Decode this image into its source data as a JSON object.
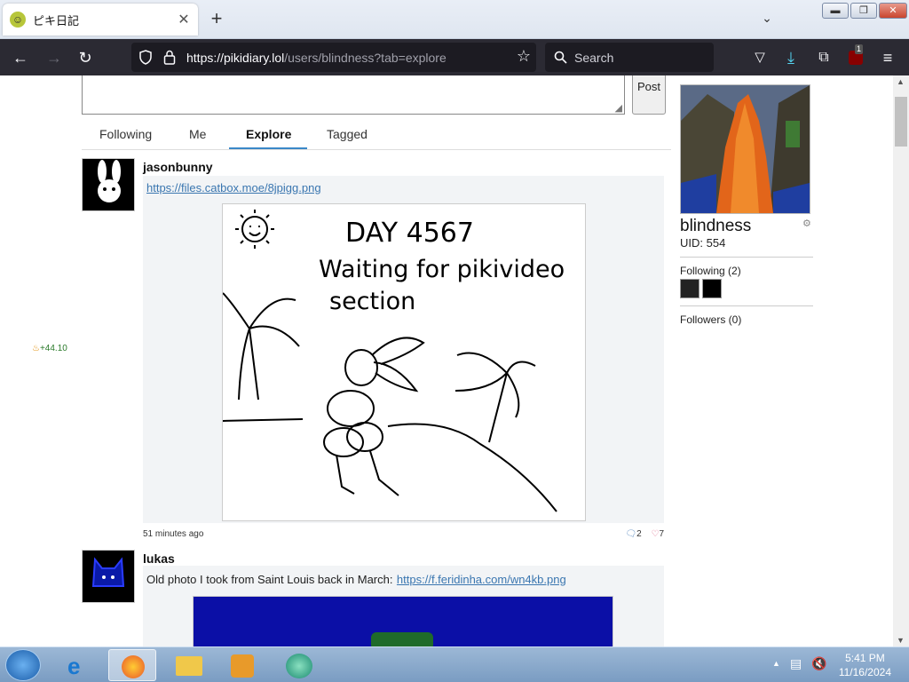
{
  "browser": {
    "tab_title": "ピキ日記",
    "url_host": "https://pikidiary.lol",
    "url_path": "/users/blindness?tab=explore",
    "search_placeholder": "Search",
    "ext_badge": "1"
  },
  "composer": {
    "post_label": "Post"
  },
  "tabs": [
    {
      "label": "Following"
    },
    {
      "label": "Me"
    },
    {
      "label": "Explore"
    },
    {
      "label": "Tagged"
    }
  ],
  "score": "+44.10",
  "posts": [
    {
      "author": "jasonbunny",
      "link": "https://files.catbox.moe/8jpigg.png",
      "drawing_lines": [
        "DAY 4567",
        "Waiting for pikivideo",
        "section"
      ],
      "time": "51 minutes ago",
      "comments": "2",
      "likes": "7"
    },
    {
      "author": "lukas",
      "text": "Old photo I took from Saint Louis back in March:",
      "link": "https://f.feridinha.com/wn4kb.png"
    }
  ],
  "profile": {
    "name": "blindness",
    "uid": "UID: 554",
    "following": "Following (2)",
    "followers": "Followers (0)"
  },
  "taskbar": {
    "time": "5:41 PM",
    "date": "11/16/2024"
  }
}
